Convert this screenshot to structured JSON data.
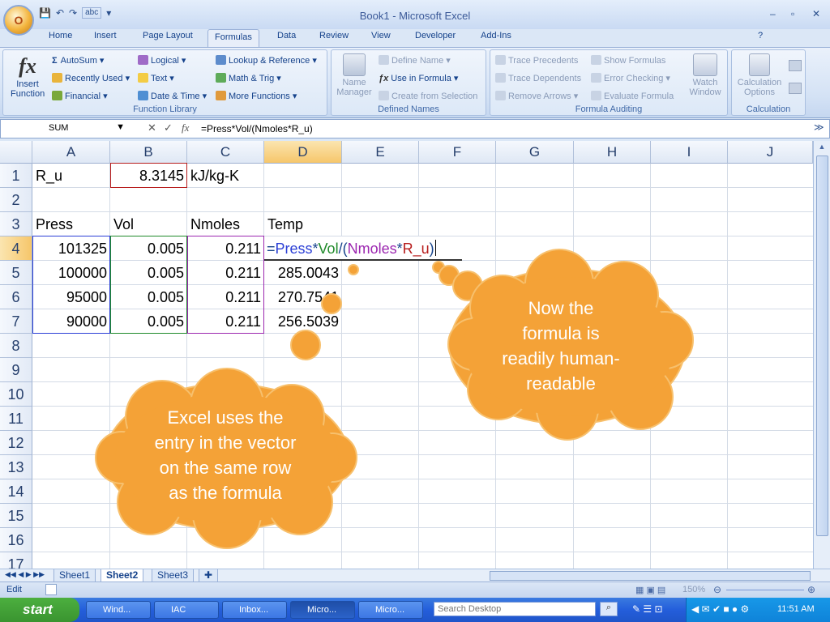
{
  "window": {
    "title": "Book1 - Microsoft Excel",
    "min": "–",
    "restore": "▫",
    "close": "✕"
  },
  "office_button": {
    "label": "O"
  },
  "quick_access": {
    "save": "💾",
    "undo": "↶",
    "redo": "↷",
    "spell": "abc",
    "more": "▾"
  },
  "tabs": [
    "Home",
    "Insert",
    "Page Layout",
    "Formulas",
    "Data",
    "Review",
    "View",
    "Developer",
    "Add-Ins"
  ],
  "active_tab": "Formulas",
  "ribbon": {
    "function_library": {
      "label": "Function Library",
      "insert_function": "Insert Function",
      "fx": "fx",
      "autosum": "AutoSum",
      "recently_used": "Recently Used",
      "financial": "Financial",
      "logical": "Logical",
      "text": "Text",
      "date_time": "Date & Time",
      "lookup": "Lookup & Reference",
      "math": "Math & Trig",
      "more": "More Functions"
    },
    "defined_names": {
      "label": "Defined Names",
      "name_manager": "Name Manager",
      "define_name": "Define Name",
      "use_in_formula": "Use in Formula",
      "create_from_selection": "Create from Selection"
    },
    "formula_auditing": {
      "label": "Formula Auditing",
      "trace_precedents": "Trace Precedents",
      "trace_dependents": "Trace Dependents",
      "remove_arrows": "Remove Arrows",
      "show_formulas": "Show Formulas",
      "error_checking": "Error Checking",
      "evaluate_formula": "Evaluate Formula",
      "watch_window": "Watch Window"
    },
    "calculation": {
      "label": "Calculation",
      "calculation_options": "Calculation Options"
    }
  },
  "formula_bar": {
    "name_box": "SUM",
    "formula": "=Press*Vol/(Nmoles*R_u)",
    "fx": "fx",
    "cancel": "✕",
    "enter": "✓"
  },
  "columns": [
    "A",
    "B",
    "C",
    "D",
    "E",
    "F",
    "G",
    "H",
    "I",
    "J"
  ],
  "rows": [
    "1",
    "2",
    "3",
    "4",
    "5",
    "6",
    "7",
    "8",
    "9",
    "10",
    "11",
    "12",
    "13",
    "14",
    "15",
    "16",
    "17"
  ],
  "cells": {
    "A1": "R_u",
    "B1": "8.3145",
    "C1": "kJ/kg-K",
    "A3": "Press",
    "B3": "Vol",
    "C3": "Nmoles",
    "D3": "Temp",
    "A4": "101325",
    "B4": "0.005",
    "C4": "0.211",
    "A5": "100000",
    "B5": "0.005",
    "C5": "0.211",
    "D5": "285.0043",
    "A6": "95000",
    "B6": "0.005",
    "C6": "0.211",
    "D6": "270.7541",
    "A7": "90000",
    "B7": "0.005",
    "C7": "0.211",
    "D7": "256.5039"
  },
  "edit_formula": {
    "p1": "=",
    "press": "Press",
    "op1": "*",
    "vol": "Vol",
    "op2": "/(",
    "nmoles": "Nmoles",
    "op3": "*",
    "ru": "R_u",
    "close": ")"
  },
  "highlight_colors": {
    "press": "#2b3fd6",
    "vol": "#1f8a2a",
    "nmoles": "#9c27b0",
    "ru": "#b71c1c"
  },
  "sheets": [
    "Sheet1",
    "Sheet2",
    "Sheet3"
  ],
  "active_sheet": "Sheet2",
  "status": {
    "mode": "Edit",
    "zoom": "150%"
  },
  "callouts": {
    "right": [
      "Now the",
      "formula is",
      "readily  human-",
      "readable"
    ],
    "left": [
      "Excel uses the",
      "entry in the vector",
      "on the same row",
      "as the formula"
    ]
  },
  "taskbar": {
    "start": "start",
    "tasks": [
      "Wind...",
      "IAC",
      "Inbox...",
      "Micro...",
      "Micro..."
    ],
    "search_placeholder": "Search Desktop",
    "clock": "11:51 AM"
  }
}
